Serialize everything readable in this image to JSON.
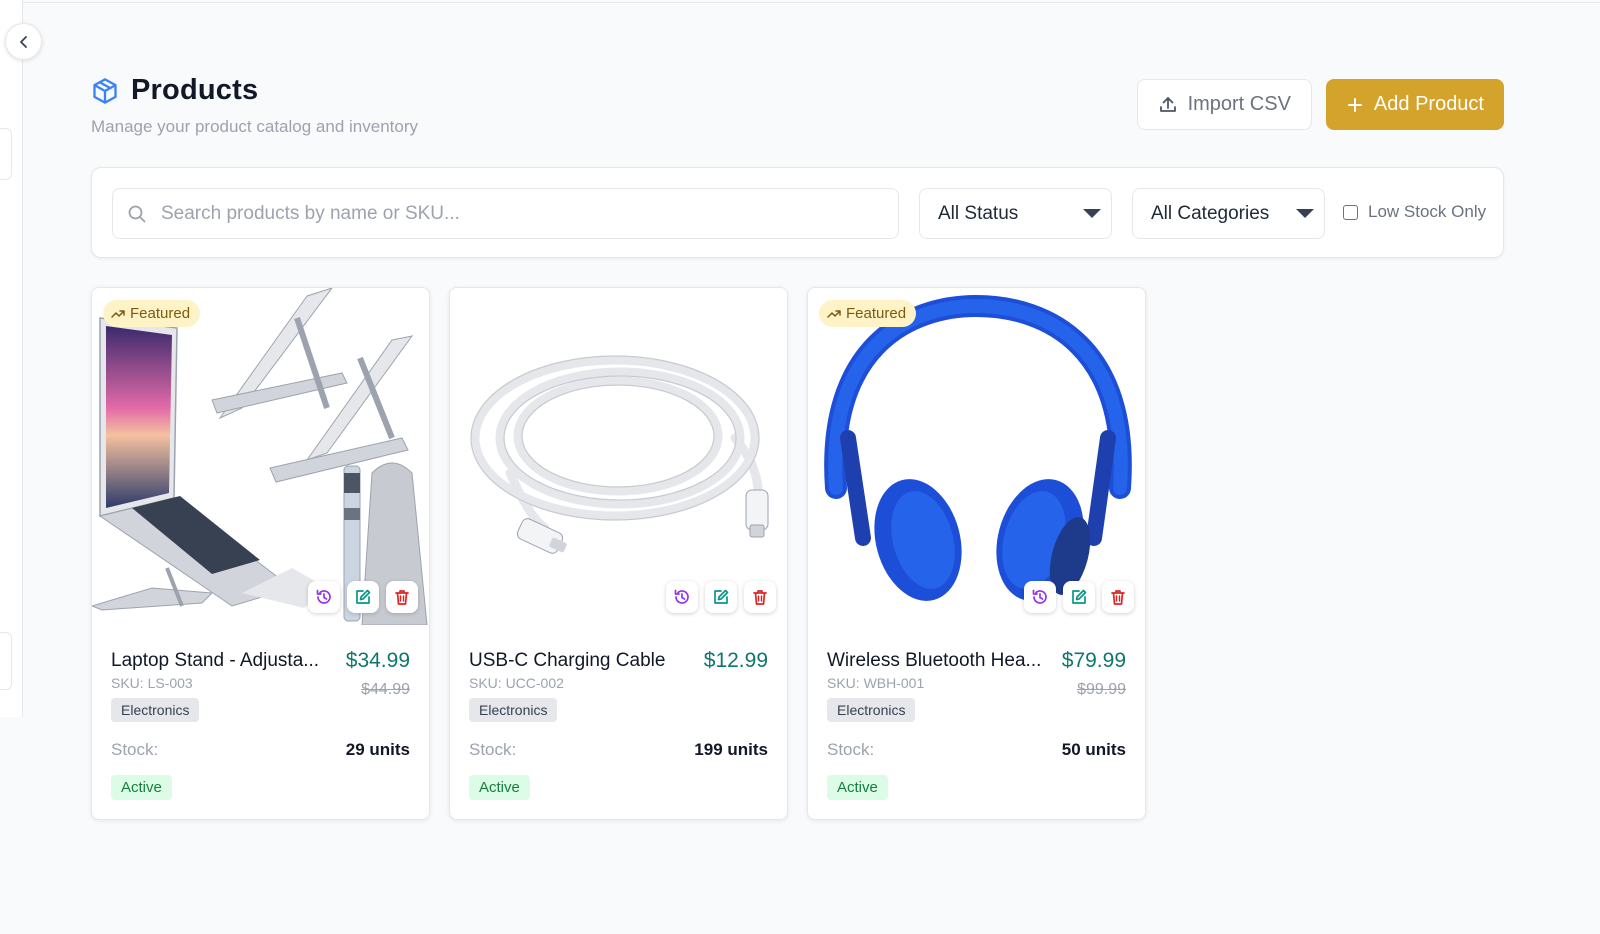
{
  "header": {
    "title": "Products",
    "subtitle": "Manage your product catalog and inventory",
    "import_label": "Import CSV",
    "add_label": "Add Product"
  },
  "filters": {
    "search_placeholder": "Search products by name or SKU...",
    "status_value": "All Status",
    "category_value": "All Categories",
    "low_stock_label": "Low Stock Only",
    "low_stock_checked": false
  },
  "products": [
    {
      "name": "Laptop Stand - Adjusta...",
      "sku": "SKU: LS-003",
      "price": "$34.99",
      "old_price": "$44.99",
      "category": "Electronics",
      "stock_label": "Stock:",
      "stock": "29 units",
      "status": "Active",
      "featured": "Featured"
    },
    {
      "name": "USB-C Charging Cable",
      "sku": "SKU: UCC-002",
      "price": "$12.99",
      "old_price": "",
      "category": "Electronics",
      "stock_label": "Stock:",
      "stock": "199 units",
      "status": "Active",
      "featured": ""
    },
    {
      "name": "Wireless Bluetooth Hea...",
      "sku": "SKU: WBH-001",
      "price": "$79.99",
      "old_price": "$99.99",
      "category": "Electronics",
      "stock_label": "Stock:",
      "stock": "50 units",
      "status": "Active",
      "featured": "Featured"
    }
  ],
  "colors": {
    "accent": "#d4a32c",
    "price": "#0f766e",
    "status_active_bg": "#dcfce7",
    "featured_bg": "#fdf3c7"
  },
  "icons": {
    "title": "cube-icon",
    "import": "upload-icon",
    "add": "plus-icon",
    "search": "search-icon",
    "featured": "trending-up-icon",
    "history": "history-icon",
    "edit": "edit-icon",
    "delete": "trash-icon",
    "collapse": "chevron-left-icon"
  }
}
